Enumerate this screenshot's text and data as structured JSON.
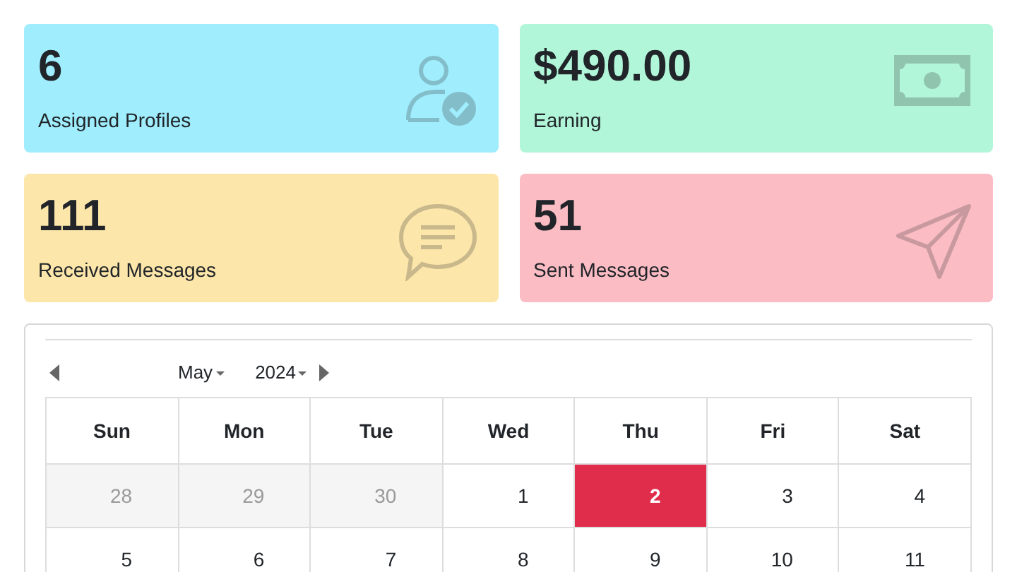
{
  "stats": [
    {
      "value": "6",
      "label": "Assigned Profiles",
      "color": "#9fedfd",
      "kind": "profile"
    },
    {
      "value": "$490.00",
      "label": "Earning",
      "color": "#b2f6d9",
      "kind": "money"
    },
    {
      "value": "111",
      "label": "Received Messages",
      "color": "#fce6aa",
      "kind": "message"
    },
    {
      "value": "51",
      "label": "Sent Messages",
      "color": "#fbbcc4",
      "kind": "send"
    }
  ],
  "calendar": {
    "month": "May",
    "year": "2024",
    "weekdays": [
      "Sun",
      "Mon",
      "Tue",
      "Wed",
      "Thu",
      "Fri",
      "Sat"
    ],
    "weeks": [
      [
        {
          "day": "28",
          "outside": true,
          "selected": false
        },
        {
          "day": "29",
          "outside": true,
          "selected": false
        },
        {
          "day": "30",
          "outside": true,
          "selected": false
        },
        {
          "day": "1",
          "outside": false,
          "selected": false
        },
        {
          "day": "2",
          "outside": false,
          "selected": true
        },
        {
          "day": "3",
          "outside": false,
          "selected": false
        },
        {
          "day": "4",
          "outside": false,
          "selected": false
        }
      ],
      [
        {
          "day": "5",
          "outside": false,
          "selected": false
        },
        {
          "day": "6",
          "outside": false,
          "selected": false
        },
        {
          "day": "7",
          "outside": false,
          "selected": false
        },
        {
          "day": "8",
          "outside": false,
          "selected": false
        },
        {
          "day": "9",
          "outside": false,
          "selected": false
        },
        {
          "day": "10",
          "outside": false,
          "selected": false
        },
        {
          "day": "11",
          "outside": false,
          "selected": false
        }
      ]
    ]
  }
}
